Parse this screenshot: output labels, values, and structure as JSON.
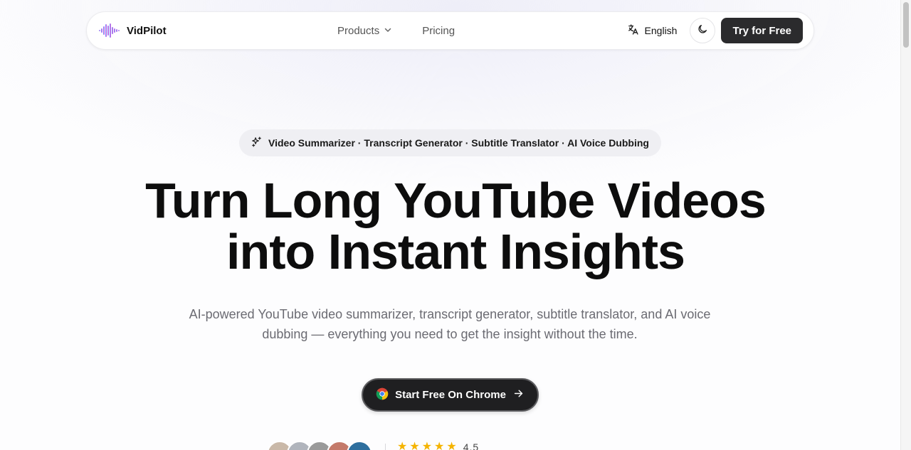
{
  "navbar": {
    "brand": "VidPilot",
    "links": [
      {
        "label": "Products",
        "has_dropdown": true
      },
      {
        "label": "Pricing"
      }
    ],
    "language": "English",
    "try_button": "Try for Free"
  },
  "hero": {
    "badge": "Video Summarizer · Transcript Generator · Subtitle Translator · AI Voice Dubbing",
    "title_line1": "Turn Long YouTube Videos",
    "title_line2": "into Instant Insights",
    "subtitle": "AI-powered YouTube video summarizer, transcript generator, subtitle translator, and AI voice dubbing — everything you need to get the insight without the time.",
    "cta_label": "Start Free On Chrome"
  },
  "social_proof": {
    "rating": "4.5",
    "stars": 5,
    "avatar_colors": [
      "#c9b8a8",
      "#b0b4bc",
      "#9a9a9a",
      "#c47a6a",
      "#2e6f9e"
    ]
  },
  "colors": {
    "accent_dark": "#2b2b2d",
    "star": "#f5b400"
  }
}
